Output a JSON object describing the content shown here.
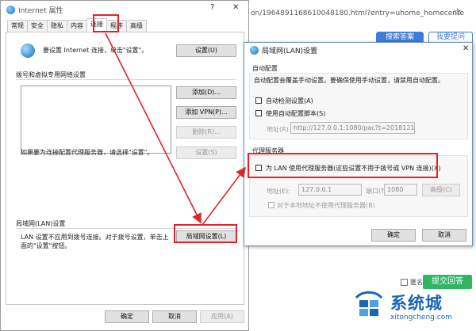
{
  "background": {
    "url": "on/196489116861004818​0.html?entry=uhome_homecente",
    "search_btn": "搜索答案",
    "ask_btn": "我要提问",
    "anonymous_label": "匿名",
    "submit_btn": "提交回答"
  },
  "internet_props": {
    "title": "Internet 属性",
    "tabs": [
      "常规",
      "安全",
      "隐私",
      "内容",
      "连接",
      "程序",
      "高级"
    ],
    "active_tab": "连接",
    "setup_text": "要设置 Internet 连接，单击\"设置\"。",
    "setup_btn": "设置(U)",
    "dialup_group": "拨号和虚拟专用网络设置",
    "add_btn": "添加(D)...",
    "add_vpn_btn": "添加 VPN(P)...",
    "remove_btn": "删除(R)...",
    "proxy_hint": "如果要为连接配置代理服务器，请选择\"设置\"。",
    "settings_btn": "设置(S)",
    "lan_group": "局域网(LAN)设置",
    "lan_desc_1": "LAN 设置不应用到拨号连接。对于拨号设置，单击上",
    "lan_desc_2": "面的\"设置\"按钮。",
    "lan_btn": "局域网设置(L)",
    "ok_btn": "确定",
    "cancel_btn": "取消",
    "apply_btn": "应用(A)"
  },
  "lan_dialog": {
    "title": "局域网(LAN)设置",
    "auto_config_group": "自动配置",
    "auto_config_desc": "自动配置会覆盖手动设置。要确保使用手动设置，请禁用自动配置。",
    "auto_detect": "自动检测设置(A)",
    "use_script": "使用自动配置脚本(S)",
    "address_label": "地址(R)",
    "script_address": "http://127.0.0.1:1080/pac?t=2018121",
    "proxy_group": "代理服务器",
    "use_proxy": "为 LAN 使用代理服务器(这些设置不用于拨号或 VPN 连接)(X)",
    "proxy_address_label": "地址(E):",
    "proxy_address": "127.0.0.1",
    "port_label": "端口(T):",
    "port": "1080",
    "advanced_btn": "高级(C)",
    "bypass_local": "对于本地地址不使用代理服务器(B)",
    "ok_btn": "确定",
    "cancel_btn": "取消"
  },
  "watermark": {
    "text": "系统城",
    "url": "xitongcheng.com"
  },
  "colors": {
    "highlight": "#e0242c",
    "brand_blue": "#1c66b6",
    "submit_green": "#2fb564"
  }
}
